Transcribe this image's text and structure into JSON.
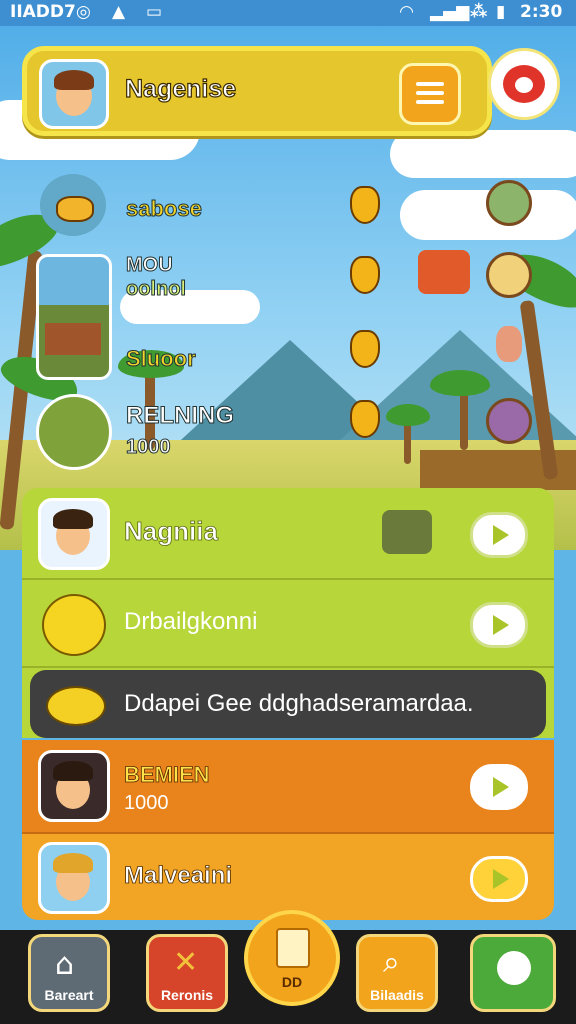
{
  "status_bar": {
    "left_text": "IIADD7",
    "time": "2:30"
  },
  "header": {
    "player_name": "Nagenise"
  },
  "scene_rows": [
    {
      "label": "sabose"
    },
    {
      "label_line1": "MOU",
      "label_line2": "oolnol"
    },
    {
      "label": "Sluoor"
    },
    {
      "label": "RELNING",
      "value": "1000"
    }
  ],
  "panel": {
    "row1": {
      "name": "Nagniia"
    },
    "row2": {
      "name": "Drbailgkonni"
    },
    "row3": {
      "message": "Ddapei Gee ddghadseramardaa."
    },
    "row4": {
      "name": "BEMIEN",
      "value": "1000"
    },
    "row5": {
      "name": "Malveaini"
    }
  },
  "nav": {
    "items": [
      {
        "label": "Bareart",
        "icon": "home-icon"
      },
      {
        "label": "Reronis",
        "icon": "tools-icon"
      },
      {
        "label": "DD",
        "icon": "document-icon"
      },
      {
        "label": "Bilaadis",
        "icon": "search-icon"
      },
      {
        "label": "",
        "icon": "profile-icon"
      }
    ]
  },
  "colors": {
    "accent": "#e5c62d",
    "panel_green": "#b7d63a",
    "panel_orange": "#ee8a1c"
  }
}
